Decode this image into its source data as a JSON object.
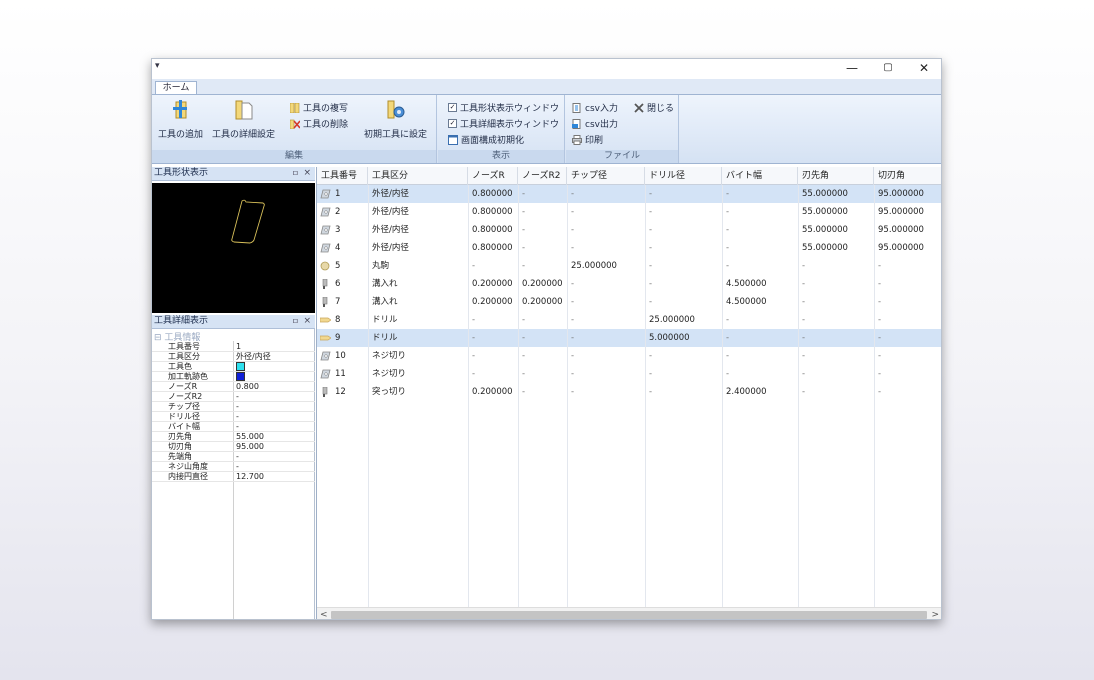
{
  "qat_glyph": "▾",
  "window_controls": {
    "minimize": "—",
    "maximize": "▢",
    "close": "✕"
  },
  "tabs": [
    {
      "label": "ホーム"
    }
  ],
  "ribbon": {
    "groups": [
      {
        "label": "編集",
        "buttons": [
          "工具の追加",
          "工具の詳細設定",
          "工具の複写",
          "工具の削除",
          "初期工具に設定"
        ]
      },
      {
        "label": "表示",
        "buttons": [
          "工具形状表示ウィンドウ",
          "工具詳細表示ウィンドウ",
          "画面構成初期化"
        ]
      },
      {
        "label": "ファイル",
        "buttons": [
          "csv入力",
          "csv出力",
          "印刷",
          "閉じる"
        ]
      }
    ],
    "add_tool": "工具の追加",
    "detail_settings": "工具の詳細設定",
    "copy_tool": "工具の複写",
    "delete_tool": "工具の削除",
    "set_initial": "初期工具に設定",
    "show_shape_window": "工具形状表示ウィンドウ",
    "show_detail_window": "工具詳細表示ウィンドウ",
    "reset_layout": "画面構成初期化",
    "csv_import": "csv入力",
    "csv_export": "csv出力",
    "print": "印刷",
    "close": "閉じる",
    "group_edit": "編集",
    "group_view": "表示",
    "group_file": "ファイル"
  },
  "shape_panel": {
    "title": "工具形状表示",
    "pin": "ㅁ",
    "close": "×"
  },
  "detail_panel": {
    "title": "工具詳細表示",
    "pin": "ㅁ",
    "close": "×",
    "category": "⊟ 工具情報",
    "props": [
      {
        "name": "工具番号",
        "value": "1"
      },
      {
        "name": "工具区分",
        "value": "外径/内径"
      },
      {
        "name": "工具色",
        "value": "",
        "color": "#2ee0ee"
      },
      {
        "name": "加工軌跡色",
        "value": "",
        "color": "#1020d8"
      },
      {
        "name": "ノーズR",
        "value": "0.800"
      },
      {
        "name": "ノーズR2",
        "value": "-"
      },
      {
        "name": "チップ径",
        "value": "-"
      },
      {
        "name": "ドリル径",
        "value": "-"
      },
      {
        "name": "バイト幅",
        "value": "-"
      },
      {
        "name": "刃先角",
        "value": "55.000"
      },
      {
        "name": "切刃角",
        "value": "95.000"
      },
      {
        "name": "先端角",
        "value": "-"
      },
      {
        "name": "ネジ山角度",
        "value": "-"
      },
      {
        "name": "内接円直径",
        "value": "12.700"
      }
    ]
  },
  "table": {
    "columns": [
      "工具番号",
      "工具区分",
      "ノーズR",
      "ノーズR2",
      "チップ径",
      "ドリル径",
      "バイト幅",
      "刃先角",
      "切刃角"
    ],
    "rows": [
      {
        "no": "1",
        "type": "外径/内径",
        "noseR": "0.800000",
        "noseR2": "-",
        "chip": "-",
        "drill": "-",
        "bite": "-",
        "tip": "55.000000",
        "cut": "95.000000",
        "selected": true,
        "icon": "turning-insert-icon"
      },
      {
        "no": "2",
        "type": "外径/内径",
        "noseR": "0.800000",
        "noseR2": "-",
        "chip": "-",
        "drill": "-",
        "bite": "-",
        "tip": "55.000000",
        "cut": "95.000000",
        "selected": false,
        "icon": "turning-insert-icon"
      },
      {
        "no": "3",
        "type": "外径/内径",
        "noseR": "0.800000",
        "noseR2": "-",
        "chip": "-",
        "drill": "-",
        "bite": "-",
        "tip": "55.000000",
        "cut": "95.000000",
        "selected": false,
        "icon": "turning-insert-icon"
      },
      {
        "no": "4",
        "type": "外径/内径",
        "noseR": "0.800000",
        "noseR2": "-",
        "chip": "-",
        "drill": "-",
        "bite": "-",
        "tip": "55.000000",
        "cut": "95.000000",
        "selected": false,
        "icon": "turning-insert-icon"
      },
      {
        "no": "5",
        "type": "丸駒",
        "noseR": "-",
        "noseR2": "-",
        "chip": "25.000000",
        "drill": "-",
        "bite": "-",
        "tip": "-",
        "cut": "-",
        "selected": false,
        "icon": "round-insert-icon"
      },
      {
        "no": "6",
        "type": "溝入れ",
        "noseR": "0.200000",
        "noseR2": "0.200000",
        "chip": "-",
        "drill": "-",
        "bite": "4.500000",
        "tip": "-",
        "cut": "-",
        "selected": false,
        "icon": "grooving-tool-icon"
      },
      {
        "no": "7",
        "type": "溝入れ",
        "noseR": "0.200000",
        "noseR2": "0.200000",
        "chip": "-",
        "drill": "-",
        "bite": "4.500000",
        "tip": "-",
        "cut": "-",
        "selected": false,
        "icon": "grooving-tool-icon"
      },
      {
        "no": "8",
        "type": "ドリル",
        "noseR": "-",
        "noseR2": "-",
        "chip": "-",
        "drill": "25.000000",
        "bite": "-",
        "tip": "-",
        "cut": "-",
        "selected": false,
        "icon": "drill-icon"
      },
      {
        "no": "9",
        "type": "ドリル",
        "noseR": "-",
        "noseR2": "-",
        "chip": "-",
        "drill": "5.000000",
        "bite": "-",
        "tip": "-",
        "cut": "-",
        "selected": true,
        "icon": "drill-icon"
      },
      {
        "no": "10",
        "type": "ネジ切り",
        "noseR": "-",
        "noseR2": "-",
        "chip": "-",
        "drill": "-",
        "bite": "-",
        "tip": "-",
        "cut": "-",
        "selected": false,
        "icon": "threading-tool-icon"
      },
      {
        "no": "11",
        "type": "ネジ切り",
        "noseR": "-",
        "noseR2": "-",
        "chip": "-",
        "drill": "-",
        "bite": "-",
        "tip": "-",
        "cut": "-",
        "selected": false,
        "icon": "threading-tool-icon"
      },
      {
        "no": "12",
        "type": "突っ切り",
        "noseR": "0.200000",
        "noseR2": "-",
        "chip": "-",
        "drill": "-",
        "bite": "2.400000",
        "tip": "-",
        "cut": "-",
        "selected": false,
        "icon": "cutoff-tool-icon"
      }
    ]
  },
  "scrollbar": {
    "left": "<",
    "right": ">"
  },
  "colors": {
    "selected_row": "#d3e3f6",
    "shape_outline": "#d8c05a",
    "ribbon_bg": "#dfe9f7"
  }
}
